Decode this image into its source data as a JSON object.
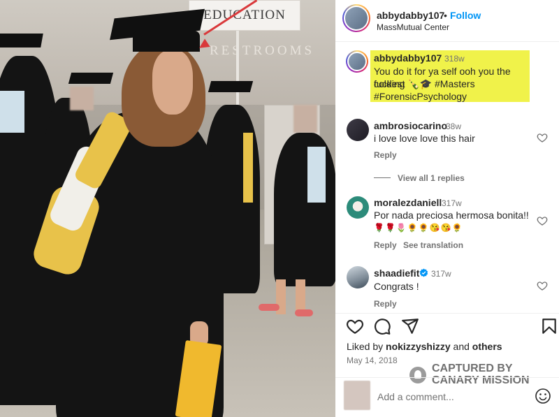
{
  "photo": {
    "sign_text": "EDUCATION",
    "wall_text": "RESTROOMS"
  },
  "post": {
    "username": "abbydabby107",
    "separator": "•",
    "follow_label": "Follow",
    "location": "MassMutual Center"
  },
  "caption": {
    "username": "abbydabby107",
    "time": "318w",
    "line1": "You do it for ya self ooh you the fucking",
    "line2": "coldest 🍾🎓 #Masters",
    "line3": "#ForensicPsychology"
  },
  "comments": [
    {
      "username": "ambrosiocarino",
      "time": "38w",
      "text": "i love love love this hair",
      "reply_label": "Reply",
      "view_replies_label": "View all 1 replies"
    },
    {
      "username": "moralezdaniell",
      "time": "317w",
      "text": "Por nada preciosa hermosa bonita!!",
      "emojis": "🌹🌹🌷🌻🌻😘😘🌻",
      "reply_label": "Reply",
      "see_translation_label": "See translation"
    },
    {
      "username": "shaadiefit",
      "time": "317w",
      "text": "Congrats !",
      "reply_label": "Reply"
    }
  ],
  "likes": {
    "prefix": "Liked by",
    "user": "nokizzyshizzy",
    "joiner": "and",
    "others": "others"
  },
  "date": "May 14, 2018",
  "watermark": {
    "line1": "CAPTURED BY",
    "line2": "CANARY MISSION"
  },
  "comment_box": {
    "placeholder": "Add a comment..."
  },
  "icons": [
    "heart-icon",
    "comment-icon",
    "share-icon",
    "bookmark-icon",
    "emoji-icon",
    "verified-icon"
  ],
  "colors": {
    "follow": "#0095f6",
    "highlight": "#f0f24a",
    "arrow": "#d9393b",
    "verified": "#0095f6"
  }
}
